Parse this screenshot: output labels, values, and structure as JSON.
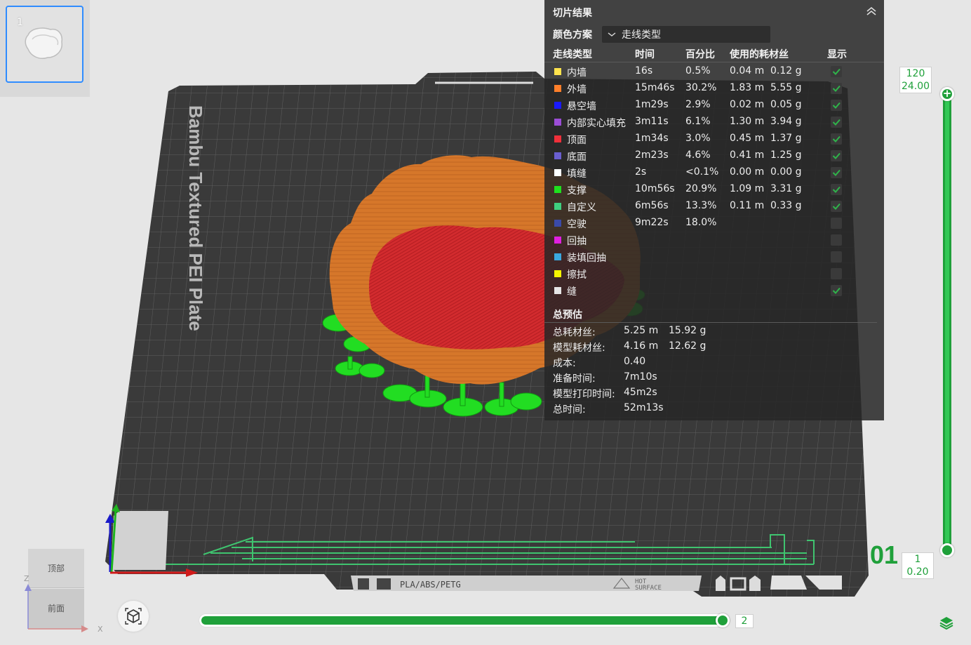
{
  "plate": {
    "number": "1"
  },
  "bed": {
    "label": "Bambu Textured PEI Plate",
    "filament_tag": "PLA/ABS/PETG",
    "hot_tag_1": "HOT",
    "hot_tag_2": "SURFACE",
    "corner_number": "01"
  },
  "panel": {
    "title": "切片结果",
    "color_scheme_label": "颜色方案",
    "color_scheme_value": "走线类型",
    "headers": {
      "type": "走线类型",
      "time": "时间",
      "percent": "百分比",
      "filament": "使用的耗材丝",
      "show": "显示"
    },
    "rows": [
      {
        "name": "内墙",
        "color": "#ffe34d",
        "time": "16s",
        "percent": "0.5%",
        "length": "0.04 m",
        "weight": "0.12 g",
        "shown": true
      },
      {
        "name": "外墙",
        "color": "#ff7f2a",
        "time": "15m46s",
        "percent": "30.2%",
        "length": "1.83 m",
        "weight": "5.55 g",
        "shown": true
      },
      {
        "name": "悬空墙",
        "color": "#1a1aff",
        "time": "1m29s",
        "percent": "2.9%",
        "length": "0.02 m",
        "weight": "0.05 g",
        "shown": true
      },
      {
        "name": "内部实心填充",
        "color": "#9b4dd6",
        "time": "3m11s",
        "percent": "6.1%",
        "length": "1.30 m",
        "weight": "3.94 g",
        "shown": true
      },
      {
        "name": "顶面",
        "color": "#f0303a",
        "time": "1m34s",
        "percent": "3.0%",
        "length": "0.45 m",
        "weight": "1.37 g",
        "shown": true
      },
      {
        "name": "底面",
        "color": "#6a5fd0",
        "time": "2m23s",
        "percent": "4.6%",
        "length": "0.41 m",
        "weight": "1.25 g",
        "shown": true
      },
      {
        "name": "填缝",
        "color": "#ffffff",
        "time": "2s",
        "percent": "<0.1%",
        "length": "0.00 m",
        "weight": "0.00 g",
        "shown": true
      },
      {
        "name": "支撑",
        "color": "#1ee01e",
        "time": "10m56s",
        "percent": "20.9%",
        "length": "1.09 m",
        "weight": "3.31 g",
        "shown": true
      },
      {
        "name": "自定义",
        "color": "#3fcf7f",
        "time": "6m56s",
        "percent": "13.3%",
        "length": "0.11 m",
        "weight": "0.33 g",
        "shown": true
      },
      {
        "name": "空驶",
        "color": "#3a4aa8",
        "time": "9m22s",
        "percent": "18.0%",
        "length": "",
        "weight": "",
        "shown": false
      },
      {
        "name": "回抽",
        "color": "#e020e0",
        "time": "",
        "percent": "",
        "length": "",
        "weight": "",
        "shown": false
      },
      {
        "name": "装填回抽",
        "color": "#3aa8e0",
        "time": "",
        "percent": "",
        "length": "",
        "weight": "",
        "shown": false
      },
      {
        "name": "擦拭",
        "color": "#f5f500",
        "time": "",
        "percent": "",
        "length": "",
        "weight": "",
        "shown": false
      },
      {
        "name": "缝",
        "color": "#e6e6e6",
        "time": "",
        "percent": "",
        "length": "",
        "weight": "",
        "shown": true
      }
    ],
    "summary_title": "总预估",
    "summary": [
      {
        "label": "总耗材丝:",
        "v1": "5.25 m",
        "v2": "15.92 g"
      },
      {
        "label": "模型耗材丝:",
        "v1": "4.16 m",
        "v2": "12.62 g"
      },
      {
        "label": "成本:",
        "v1": "0.40",
        "v2": ""
      },
      {
        "label": "准备时间:",
        "v1": "7m10s",
        "v2": ""
      },
      {
        "label": "模型打印时间:",
        "v1": "45m2s",
        "v2": ""
      },
      {
        "label": "总时间:",
        "v1": "52m13s",
        "v2": ""
      }
    ]
  },
  "layer_slider": {
    "top_layer": "120",
    "top_height": "24.00",
    "bottom_layer": "1",
    "bottom_height": "0.20",
    "upper_position": 1.0,
    "lower_position": 0.0
  },
  "move_slider": {
    "value": "2",
    "position": 1.0
  },
  "view_cube": {
    "top": "顶部",
    "front": "前面",
    "axis_z": "Z",
    "axis_x": "X"
  },
  "colors": {
    "accent": "#1fa03a",
    "selection": "#2f8cff",
    "panel_bg": "#262626",
    "wall": "#d9792a",
    "top_surface": "#d12a2a",
    "support": "#22dd22"
  }
}
